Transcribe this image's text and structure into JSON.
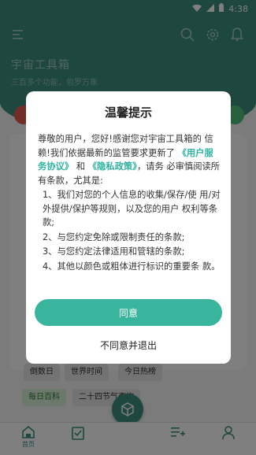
{
  "status_bar": {
    "time": "4:38"
  },
  "app": {
    "title": "宇宙工具箱",
    "subtitle": "三百多个功能，包罗万象"
  },
  "chips": [
    {
      "label": "倒数日"
    },
    {
      "label": "世界时间"
    },
    {
      "label": "今日热榜"
    },
    {
      "label": "每日百科"
    },
    {
      "label": "二十四节气查询"
    }
  ],
  "bottom_nav": {
    "home_label": "首页"
  },
  "dialog": {
    "title": "温馨提示",
    "intro_1": "尊敬的用户，您好!感谢您对宇宙工具箱的 信赖!我们依据最新的监管要求更新了",
    "link_terms": "《用户服务协议》",
    "and": "和",
    "link_privacy": "《隐私政策》",
    "intro_2": "，请务 必审慎阅读所有条款，尤其是:",
    "items": [
      "1、我们对您的个人信息的收集/保存/使 用/对外提供/保护等规则，以及您的用户 权利等条款;",
      "2、与您约定免除或限制责任的条款;",
      "3、与您约定法律适用和管辖的条款;",
      "4、其他以颜色或粗体进行标识的重要条 款。"
    ],
    "agree_label": "同意",
    "disagree_label": "不同意并退出"
  },
  "colors": {
    "primary": "#3a8f7f",
    "accent": "#38b59c",
    "link": "#2eb3a0"
  }
}
